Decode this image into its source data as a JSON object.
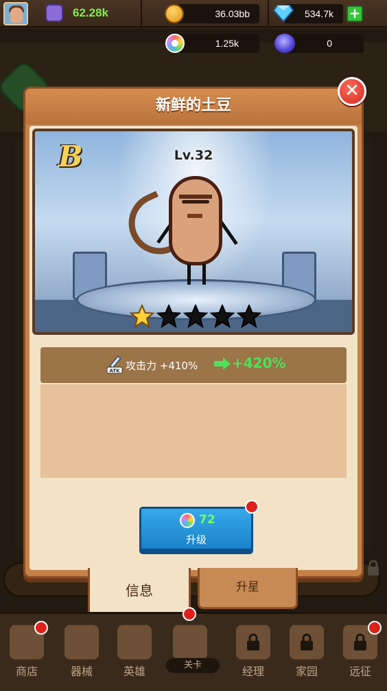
{
  "resources": {
    "power": "62.28k",
    "coins": "36.03bb",
    "gems": "534.7k",
    "swirl": "1.25k",
    "orbs": "0"
  },
  "modal": {
    "title": "新鲜的土豆",
    "grade": "B",
    "level": "Lv.32",
    "stars_filled": 1,
    "stars_total": 5,
    "stat": {
      "icon_label": "ATK",
      "label": "攻击力 +410%",
      "next": "+420%"
    },
    "upgrade": {
      "cost": "72",
      "label": "升级"
    },
    "tabs": [
      "信息",
      "升星"
    ]
  },
  "bottom_nav": [
    {
      "label": "商店",
      "badge": true
    },
    {
      "label": "器械",
      "badge": false
    },
    {
      "label": "英雄",
      "badge": false
    },
    {
      "label": "关卡",
      "badge": true
    },
    {
      "label": "经理",
      "badge": false
    },
    {
      "label": "家园",
      "badge": false
    },
    {
      "label": "远征",
      "badge": true
    }
  ],
  "colors": {
    "power_green": "#7cf04a",
    "upgrade_blue": "#1a82c9",
    "next_green": "#4ee05a",
    "badge_red": "#e0211b"
  }
}
